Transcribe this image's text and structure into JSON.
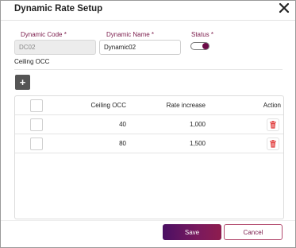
{
  "dialog": {
    "title": "Dynamic Rate Setup",
    "close_icon": "close-icon"
  },
  "form": {
    "dynamic_code": {
      "label": "Dynamic Code",
      "required_mark": "*",
      "value": "DC02",
      "disabled": true
    },
    "dynamic_name": {
      "label": "Dynamic Name",
      "required_mark": "*",
      "value": "Dynamic02"
    },
    "status": {
      "label": "Status",
      "required_mark": "*",
      "on": true
    }
  },
  "section": {
    "title": "Ceiling OCC",
    "add_icon": "plus-icon",
    "add_label": "+"
  },
  "table": {
    "headers": {
      "occ": "Ceiling OCC",
      "rate": "Rate increase",
      "action": "Action"
    },
    "rows": [
      {
        "occ": "40",
        "rate": "1,000",
        "action_icon": "trash-icon"
      },
      {
        "occ": "80",
        "rate": "1,500",
        "action_icon": "trash-icon"
      }
    ]
  },
  "footer": {
    "save_label": "Save",
    "cancel_label": "Cancel"
  },
  "colors": {
    "accent": "#7a1a4a",
    "save_gradient_start": "#4a0f63",
    "save_gradient_end": "#8e1c4e",
    "delete_icon": "#e03a3a"
  }
}
